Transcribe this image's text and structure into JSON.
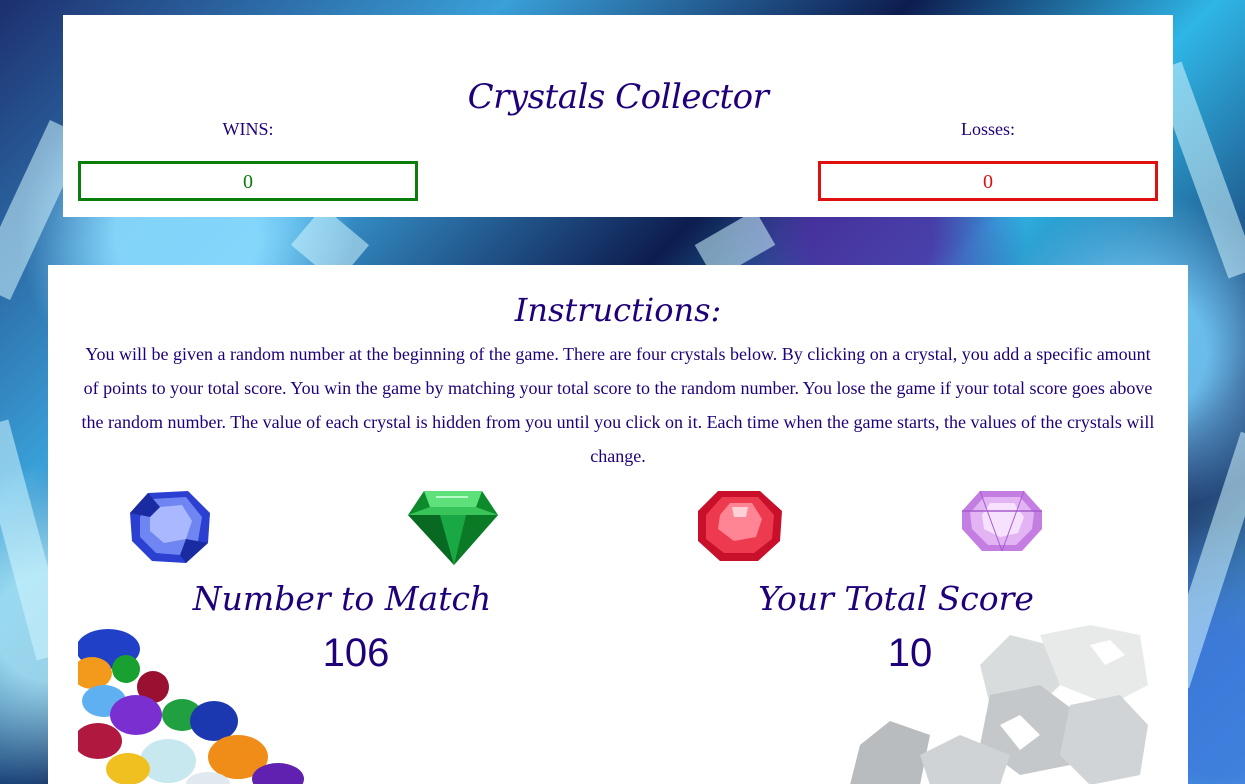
{
  "header": {
    "title": "Crystals Collector",
    "wins_label": "WINS:",
    "wins_value": "0",
    "losses_label": "Losses:",
    "losses_value": "0"
  },
  "instructions": {
    "title": "Instructions:",
    "text": "You will be given a random number at the beginning of the game. There are four crystals below. By clicking on a crystal, you add a specific amount of points to your total score. You win the game by matching your total score to the random number. You lose the game if your total score goes above the random number. The value of each crystal is hidden from you until you click on it. Each time when the game starts, the values of the crystals will change."
  },
  "crystals": [
    {
      "name": "blue-crystal",
      "color": "#2f46d8"
    },
    {
      "name": "green-crystal",
      "color": "#0e9a36"
    },
    {
      "name": "red-crystal",
      "color": "#e0182e"
    },
    {
      "name": "purple-crystal",
      "color": "#c98ae6"
    }
  ],
  "match": {
    "label": "Number to Match",
    "value": "106"
  },
  "score": {
    "label": "Your Total Score",
    "value": "10"
  },
  "colors": {
    "text": "#1f007a",
    "wins": "#0a7d0a",
    "losses": "#e01010"
  }
}
